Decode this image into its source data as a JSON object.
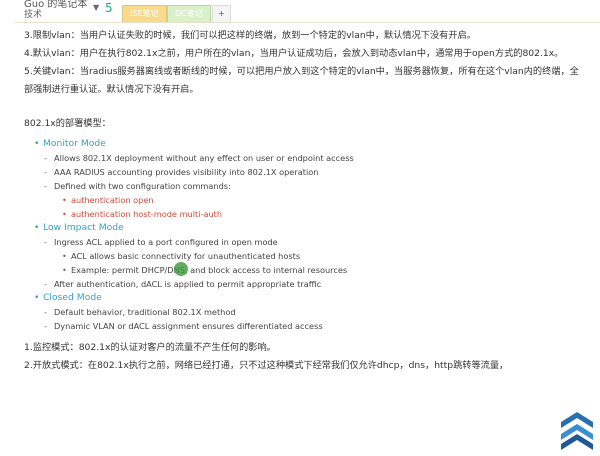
{
  "notebook": {
    "name": "Guo 的笔记本",
    "section": "技术",
    "count": "5"
  },
  "tabs": [
    {
      "label": "ISE笔记"
    },
    {
      "label": "DC笔记"
    },
    {
      "label": "+"
    }
  ],
  "paragraphs": {
    "p1": "3.限制vlan：当用户认证失败的时候，我们可以把这样的终端，放到一个特定的vlan中，默认情况下没有开启。",
    "p2": "4.默认vlan：用户在执行802.1x之前，用户所在的vlan，当用户认证成功后，会放入到动态vlan中，通常用于open方式的802.1x。",
    "p3": "5.关键vlan：当radius服务器离线或者断线的时候，可以把用户放入到这个特定的vlan中，当服务器恢复，所有在这个vlan内的终端，全部强制进行重认证。默认情况下没有开启。",
    "heading": "802.1x的部署模型：",
    "p4": "1.监控模式：802.1x的认证对客户的流量不产生任何的影响。",
    "p5": "2.开放式模式：在802.1x执行之前，网络已经打通，只不过这种模式下经常我们仅允许dhcp，dns，http跳转等流量，"
  },
  "models": [
    {
      "title": "Monitor Mode",
      "items": [
        {
          "text": "Allows 802.1X deployment without any effect on user or endpoint access"
        },
        {
          "text": "AAA RADIUS accounting provides visibility into 802.1X operation"
        },
        {
          "text": "Defined with two configuration commands:",
          "sub": [
            "authentication open",
            "authentication host-mode multi-auth"
          ]
        }
      ]
    },
    {
      "title": "Low Impact Mode",
      "items": [
        {
          "text": "Ingress ACL applied to a port configured in open mode",
          "sub": [
            "ACL allows basic connectivity for unauthenticated hosts",
            "Example: permit DHCP/DNS, and block access to internal resources"
          ]
        },
        {
          "text": "After authentication, dACL is applied to permit appropriate traffic"
        }
      ]
    },
    {
      "title": "Closed Mode",
      "items": [
        {
          "text": "Default behavior, traditional 802.1X method"
        },
        {
          "text": "Dynamic VLAN or dACL assignment ensures differentiated access"
        }
      ]
    }
  ],
  "colors": {
    "accent": "#35a0c8",
    "command": "#d04a3a",
    "tab_active": "#f9d98a",
    "tab_green": "#d9f0c8"
  }
}
